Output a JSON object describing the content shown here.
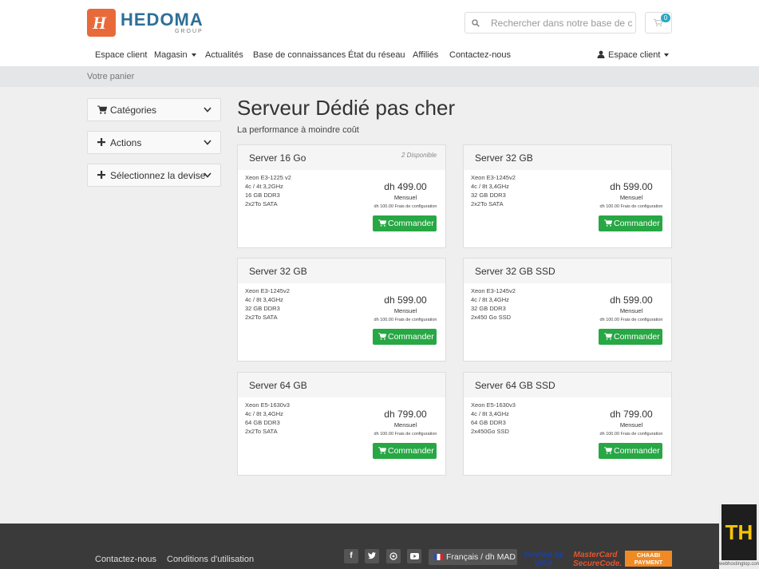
{
  "brand": {
    "logo_letter": "H",
    "name": "HEDOMA",
    "sub": "GROUP"
  },
  "search": {
    "placeholder": "Rechercher dans notre base de connaissances..."
  },
  "cart": {
    "count": "0"
  },
  "nav": {
    "items": [
      "Espace client",
      "Magasin",
      "Actualités",
      "Base de connaissances",
      "État du réseau",
      "Affiliés",
      "Contactez-nous"
    ],
    "account": "Espace client"
  },
  "breadcrumb": "Votre panier",
  "sidebar": {
    "categories": "Catégories",
    "actions": "Actions",
    "currency": "Sélectionnez la devise"
  },
  "page": {
    "title": "Serveur Dédié pas cher",
    "subtitle": "La performance à moindre coût"
  },
  "order_label": "Commander",
  "products": [
    {
      "name": "Server 16 Go",
      "availability": "2 Disponible",
      "specs": [
        "Xeon E3-1225 v2",
        "4c / 4t 3,2GHz",
        "16 GB DDR3",
        "2x2To SATA"
      ],
      "price": "dh 499.00",
      "cycle": "Mensuel",
      "setup": "dh 100.00 Frais de configuration"
    },
    {
      "name": "Server 32 GB",
      "availability": "",
      "specs": [
        "Xeon E3-1245v2",
        "4c / 8t 3,4GHz",
        "32 GB DDR3",
        "2x2To SATA"
      ],
      "price": "dh 599.00",
      "cycle": "Mensuel",
      "setup": "dh 100.00 Frais de configuration"
    },
    {
      "name": "Server 32 GB",
      "availability": "",
      "specs": [
        "Xeon E3-1245v2",
        "4c / 8t 3,4GHz",
        "32 GB DDR3",
        "2x2To SATA"
      ],
      "price": "dh 599.00",
      "cycle": "Mensuel",
      "setup": "dh 100.00 Frais de configuration"
    },
    {
      "name": "Server 32 GB SSD",
      "availability": "",
      "specs": [
        "Xeon E3-1245v2",
        "4c / 8t 3,4GHz",
        "32 GB DDR3",
        "2x450 Go SSD"
      ],
      "price": "dh 599.00",
      "cycle": "Mensuel",
      "setup": "dh 100.00 Frais de configuration"
    },
    {
      "name": "Server 64 GB",
      "availability": "",
      "specs": [
        "Xeon E5-1630v3",
        "4c / 8t 3,4GHz",
        "64 GB DDR3",
        "2x2To SATA"
      ],
      "price": "dh 799.00",
      "cycle": "Mensuel",
      "setup": "dh 100.00 Frais de configuration"
    },
    {
      "name": "Server 64 GB SSD",
      "availability": "",
      "specs": [
        "Xeon E5-1630v3",
        "4c / 8t 3,4GHz",
        "64 GB DDR3",
        "2x450Go SSD"
      ],
      "price": "dh 799.00",
      "cycle": "Mensuel",
      "setup": "dh 100.00 Frais de configuration"
    }
  ],
  "footer": {
    "links": [
      "Contactez-nous",
      "Conditions d'utilisation"
    ],
    "social": [
      "facebook-icon",
      "twitter-icon",
      "whatsapp-icon",
      "youtube-icon"
    ],
    "language": "Français / dh MAD",
    "payments": [
      "Verified by VISA",
      "MasterCard SecureCode.",
      "CHAABI PAYMENT"
    ]
  },
  "watermark": {
    "mark": "TH",
    "url": "webhostingtop.com"
  },
  "colors": {
    "accent": "#28a745",
    "brand_orange": "#e86a3a",
    "brand_blue": "#2f6f98",
    "footer": "#3a3a3a"
  }
}
